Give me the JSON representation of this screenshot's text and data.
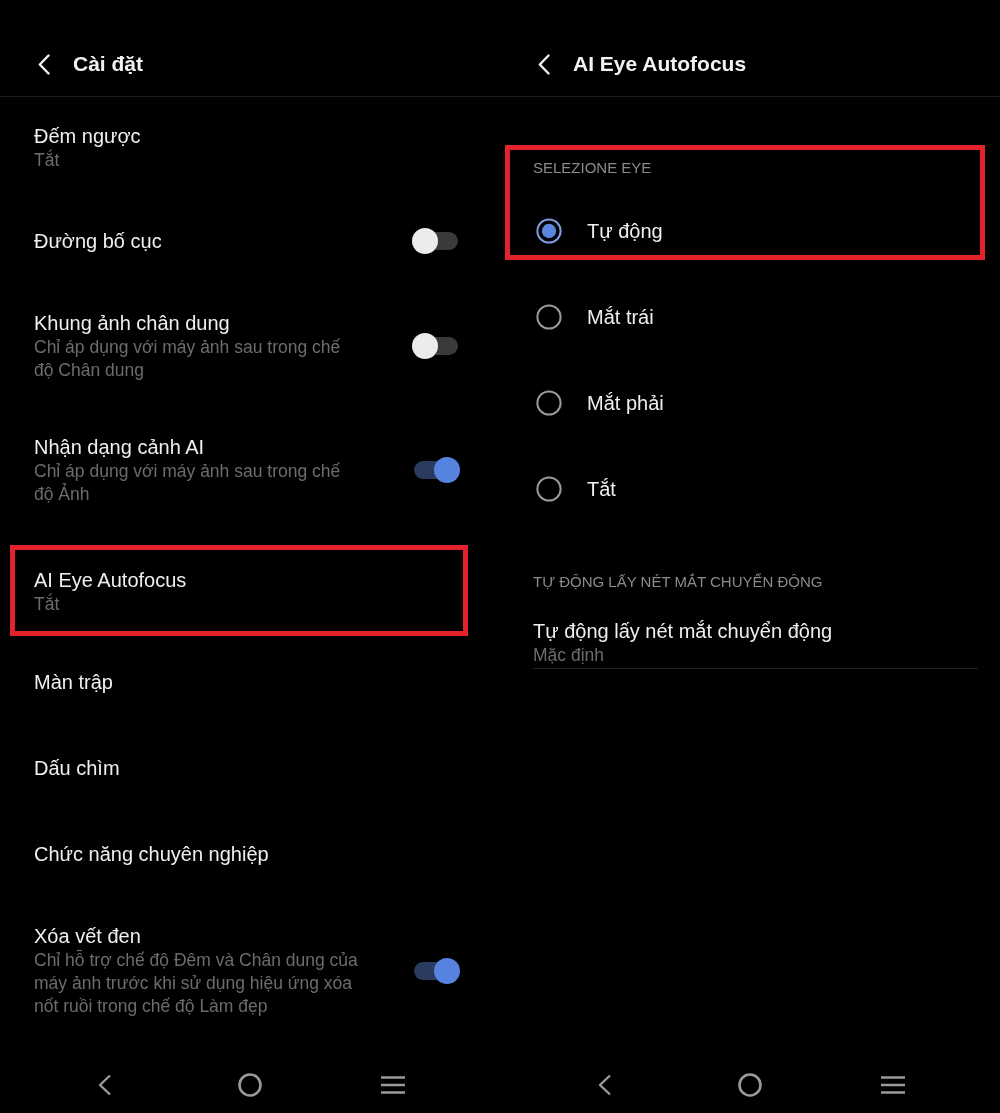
{
  "left_screen": {
    "header": {
      "title": "Cài đặt"
    },
    "items": [
      {
        "kind": "value",
        "title": "Đếm ngược",
        "subtitle": "Tắt",
        "highlighted": false
      },
      {
        "kind": "switch",
        "title": "Đường bố cục",
        "on": false,
        "highlighted": false
      },
      {
        "kind": "switch",
        "title": "Khung ảnh chân dung",
        "subtitle": "Chỉ áp dụng với máy ảnh sau trong chế độ Chân dung",
        "on": false,
        "highlighted": false
      },
      {
        "kind": "switch",
        "title": "Nhận dạng cảnh AI",
        "subtitle": "Chỉ áp dụng với máy ảnh sau trong chế độ Ảnh",
        "on": true,
        "highlighted": false
      },
      {
        "kind": "value",
        "title": "AI Eye Autofocus",
        "subtitle": "Tắt",
        "highlighted": true
      },
      {
        "kind": "value",
        "title": "Màn trập",
        "highlighted": false
      },
      {
        "kind": "value",
        "title": "Dấu chìm",
        "highlighted": false
      },
      {
        "kind": "value",
        "title": "Chức năng chuyên nghiệp",
        "highlighted": false
      },
      {
        "kind": "switch",
        "title": "Xóa vết đen",
        "subtitle": "Chỉ hỗ trợ chế độ Đêm và Chân dung của máy ảnh trước khi sử dụng hiệu ứng xóa nốt ruồi trong chế độ Làm đẹp",
        "on": true,
        "highlighted": false
      }
    ]
  },
  "right_screen": {
    "header": {
      "title": "AI Eye Autofocus"
    },
    "rows": [
      {
        "kind": "section",
        "text": "SELEZIONE EYE",
        "highlighted": true
      },
      {
        "kind": "radio",
        "label": "Tự động",
        "selected": true,
        "highlighted": true
      },
      {
        "kind": "radio",
        "label": "Mắt trái",
        "selected": false,
        "highlighted": false
      },
      {
        "kind": "radio",
        "label": "Mắt phải",
        "selected": false,
        "highlighted": false
      },
      {
        "kind": "radio",
        "label": "Tắt",
        "selected": false,
        "highlighted": false
      },
      {
        "kind": "section",
        "text": "TỰ ĐỘNG LẤY NÉT MẮT CHUYỂN ĐỘNG",
        "highlighted": false
      },
      {
        "kind": "value",
        "title": "Tự động lấy nét mắt chuyển động",
        "subtitle": "Mặc định",
        "highlighted": false
      }
    ]
  }
}
